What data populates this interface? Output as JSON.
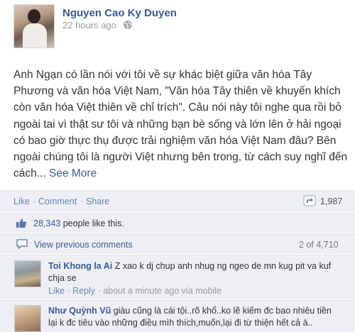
{
  "post": {
    "author": "Nguyen Cao Ky Duyen",
    "time": "22 hours ago",
    "privacy_icon": "globe-icon",
    "text": "Anh Ngạn có lần nói với tôi về sự khác biệt giữa văn hóa Tây Phương và văn hóa Việt Nam, \"Văn hóa Tây thiên về khuyến khích còn văn hóa Việt thiên về chỉ trích\". Câu nói này tôi nghe qua rồi bỏ ngoài tai vì thật sư tôi và những bạn bè sống và lớn lên ở hải ngoại có bao giờ thực thụ được trải nghiệm văn hóa Việt Nam đâu? Bên ngoài chúng tôi là người Việt nhưng bên trong, từ cách suy nghĩ đến cách...",
    "see_more": "See More"
  },
  "actions": {
    "like": "Like",
    "comment": "Comment",
    "share": "Share",
    "separator": "·",
    "share_icon": "share-icon",
    "share_count": "1,987"
  },
  "likes": {
    "icon": "thumbs-up-icon",
    "count": "28,343",
    "suffix": " people like this."
  },
  "previous_comments": {
    "icon": "comment-icon",
    "label": "View previous comments",
    "count": "2 of 4,710"
  },
  "comments": [
    {
      "author": "Toi Khong la Ai",
      "text": "Z xao k dj chup anh nhug ng ngeo de mn kug pit va kuf chja se",
      "like": "Like",
      "reply": "Reply",
      "time": "about a minute ago via mobile"
    },
    {
      "author": "Như Quỳnh Vũ",
      "text": "giàu cũng là cái tội..rõ khổ..ko lẽ kiếm đc bao nhiêu tiền lại k đc tiêu vào những điều mìh thích,muốn,lại đi từ thiện hết cả à.."
    }
  ],
  "colors": {
    "link": "#3b5998",
    "action_link": "#6d84b4",
    "panel_bg": "#edeff4",
    "meta": "#999999"
  }
}
